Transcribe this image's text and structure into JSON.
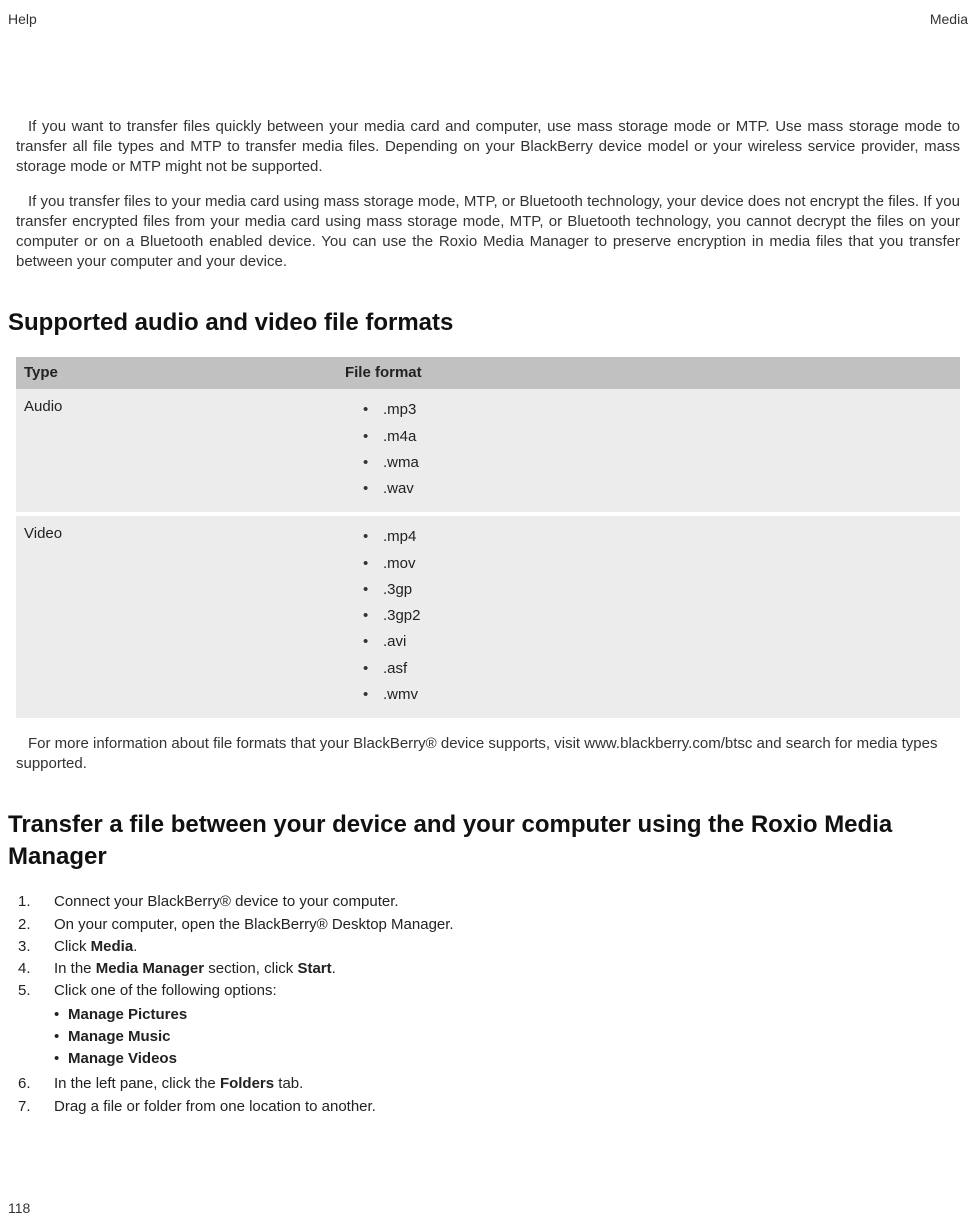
{
  "header": {
    "left": "Help",
    "right": "Media"
  },
  "intro": {
    "p1": "If you want to transfer files quickly between your media card and computer, use mass storage mode or MTP. Use mass storage mode to transfer all file types and MTP to transfer media files. Depending on your BlackBerry device model or your wireless service provider, mass storage mode or MTP might not be supported.",
    "p2": "If you transfer files to your media card using mass storage mode, MTP, or Bluetooth technology, your device does not encrypt the files. If you transfer encrypted files from your media card using mass storage mode, MTP, or Bluetooth technology, you cannot decrypt the files on your computer or on a Bluetooth enabled device. You can use the Roxio Media Manager to preserve encryption in media files that you transfer between your computer and your device."
  },
  "formats": {
    "heading": "Supported audio and video file formats",
    "th1": "Type",
    "th2": "File format",
    "rows": [
      {
        "type": "Audio",
        "items": [
          ".mp3",
          ".m4a",
          ".wma",
          ".wav"
        ]
      },
      {
        "type": "Video",
        "items": [
          ".mp4",
          ".mov",
          ".3gp",
          ".3gp2",
          ".avi",
          ".asf",
          ".wmv"
        ]
      }
    ],
    "note": "For more information about file formats that your BlackBerry® device supports, visit www.blackberry.com/btsc and search for media types supported."
  },
  "transfer": {
    "heading": "Transfer a file between your device and your computer using the Roxio Media Manager",
    "steps": {
      "s1": "Connect your BlackBerry® device to your computer.",
      "s2": "On your computer, open the BlackBerry® Desktop Manager.",
      "s3_pre": "Click ",
      "s3_b": "Media",
      "s3_post": ".",
      "s4_pre": "In the ",
      "s4_b1": "Media Manager",
      "s4_mid": " section, click ",
      "s4_b2": "Start",
      "s4_post": ".",
      "s5": "Click one of the following options:",
      "s5_opts": [
        "Manage Pictures",
        "Manage Music",
        "Manage Videos"
      ],
      "s6_pre": "In the left pane, click the ",
      "s6_b": "Folders",
      "s6_post": " tab.",
      "s7": "Drag a file or folder from one location to another."
    }
  },
  "page": "118"
}
